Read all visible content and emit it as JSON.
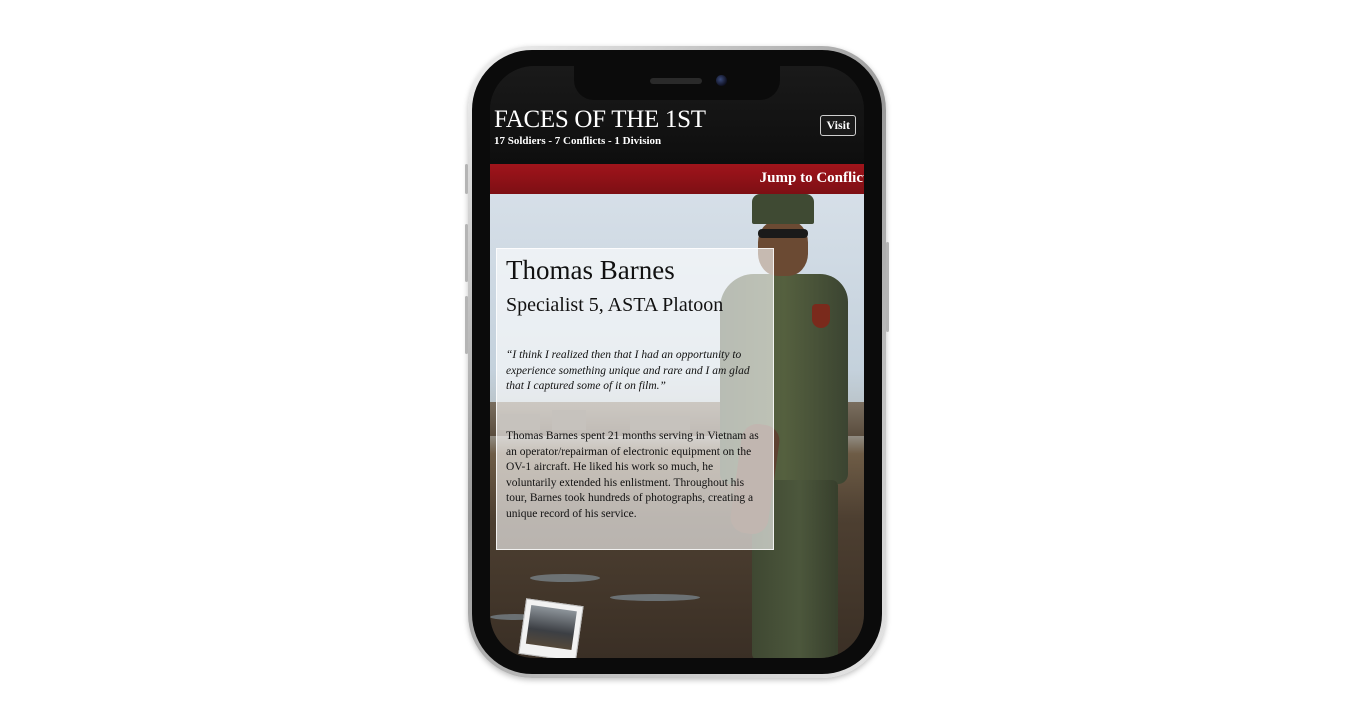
{
  "app": {
    "title": "FACES OF THE 1ST",
    "subtitle": "17 Soldiers - 7 Conflicts - 1 Division",
    "visit_label": "Visit"
  },
  "nav": {
    "jump_label": "Jump to Conflict"
  },
  "profile": {
    "name": "Thomas Barnes",
    "rank": "Specialist 5, ASTA Platoon",
    "quote": "“I think I realized then that I had an opportunity to experience something unique and rare and I am glad that I captured some of it on film.”",
    "bio": "Thomas Barnes spent 21 months serving in Vietnam as an operator/repairman of electronic equipment on the OV-1 aircraft. He liked his work so much, he voluntarily extended his enlistment. Throughout his tour, Barnes took hundreds of photographs, creating a unique record of his service."
  },
  "colors": {
    "header_bg": "#111111",
    "accent_red": "#8e1218",
    "text_dark": "#111111",
    "device_frame": "#0b0b0b"
  }
}
